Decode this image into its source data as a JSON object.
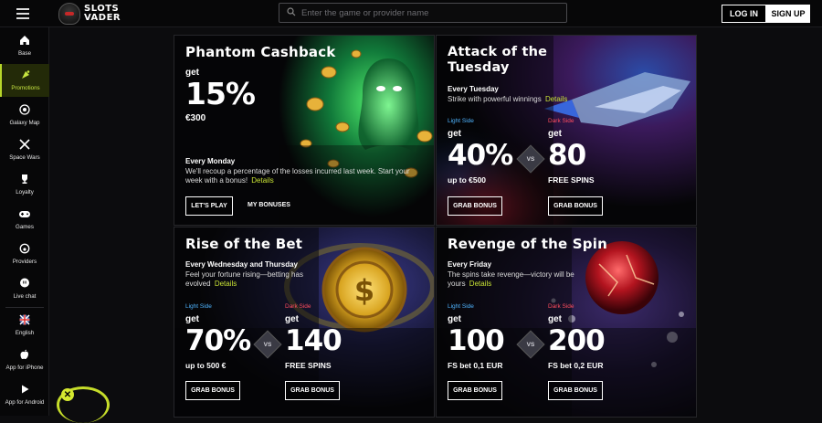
{
  "header": {
    "logo_line1": "SLOTS",
    "logo_line2": "VADER",
    "search_placeholder": "Enter the game or provider name",
    "login_label": "LOG IN",
    "signup_label": "SIGN UP"
  },
  "sidebar": {
    "items": [
      {
        "label": "Base",
        "icon": "home-icon"
      },
      {
        "label": "Promotions",
        "icon": "promo-icon"
      },
      {
        "label": "Galaxy Map",
        "icon": "galaxy-icon"
      },
      {
        "label": "Space Wars",
        "icon": "swords-icon"
      },
      {
        "label": "Loyalty",
        "icon": "trophy-icon"
      },
      {
        "label": "Games",
        "icon": "gamepad-icon"
      },
      {
        "label": "Providers",
        "icon": "providers-icon"
      },
      {
        "label": "Live chat",
        "icon": "chat-icon"
      },
      {
        "label": "English",
        "icon": "uk-flag-icon"
      },
      {
        "label": "App for iPhone",
        "icon": "apple-icon"
      },
      {
        "label": "App for Android",
        "icon": "android-icon"
      }
    ],
    "accent": "#c7e540"
  },
  "promos": {
    "cashback": {
      "title": "Phantom Cashback",
      "get": "get",
      "percent": "15%",
      "amount": "€300",
      "day": "Every Monday",
      "text": "We'll recoup a percentage of the losses incurred last week. Start your week with a bonus!",
      "details": "Details",
      "play_btn": "LET'S PLAY",
      "bonuses_btn": "MY BONUSES"
    },
    "tuesday": {
      "title_line1": "Attack of the",
      "title_line2": "Tuesday",
      "day": "Every Tuesday",
      "text": "Strike with powerful winnings",
      "details": "Details",
      "light_label": "Light Side",
      "dark_label": "Dark Side",
      "light_get": "get",
      "dark_get": "get",
      "light_value": "40%",
      "light_sub": "up to €500",
      "dark_value": "80",
      "dark_sub": "FREE SPINS",
      "vs": "VS",
      "btn1": "GRAB BONUS",
      "btn2": "GRAB BONUS"
    },
    "rise": {
      "title": "Rise of the Bet",
      "day": "Every Wednesday and Thursday",
      "text": "Feel your fortune rising—betting has evolved",
      "details": "Details",
      "light_label": "Light Side",
      "dark_label": "Dark Side",
      "light_get": "get",
      "dark_get": "get",
      "light_value": "70%",
      "light_sub": "up to 500 €",
      "dark_value": "140",
      "dark_sub": "FREE SPINS",
      "vs": "VS",
      "btn1": "GRAB BONUS",
      "btn2": "GRAB BONUS"
    },
    "revenge": {
      "title": "Revenge of the Spin",
      "day": "Every Friday",
      "text": "The spins take revenge—victory will be yours",
      "details": "Details",
      "light_label": "Light Side",
      "dark_label": "Dark Side",
      "light_get": "get",
      "dark_get": "get",
      "light_value": "100",
      "light_sub": "FS bet 0,1 EUR",
      "dark_value": "200",
      "dark_sub": "FS bet 0,2 EUR",
      "vs": "VS",
      "btn1": "GRAB BONUS",
      "btn2": "GRAB BONUS"
    }
  },
  "colors": {
    "light_side": "#4fb4ff",
    "dark_side": "#ff4d5e",
    "details_link": "#c8e235"
  }
}
